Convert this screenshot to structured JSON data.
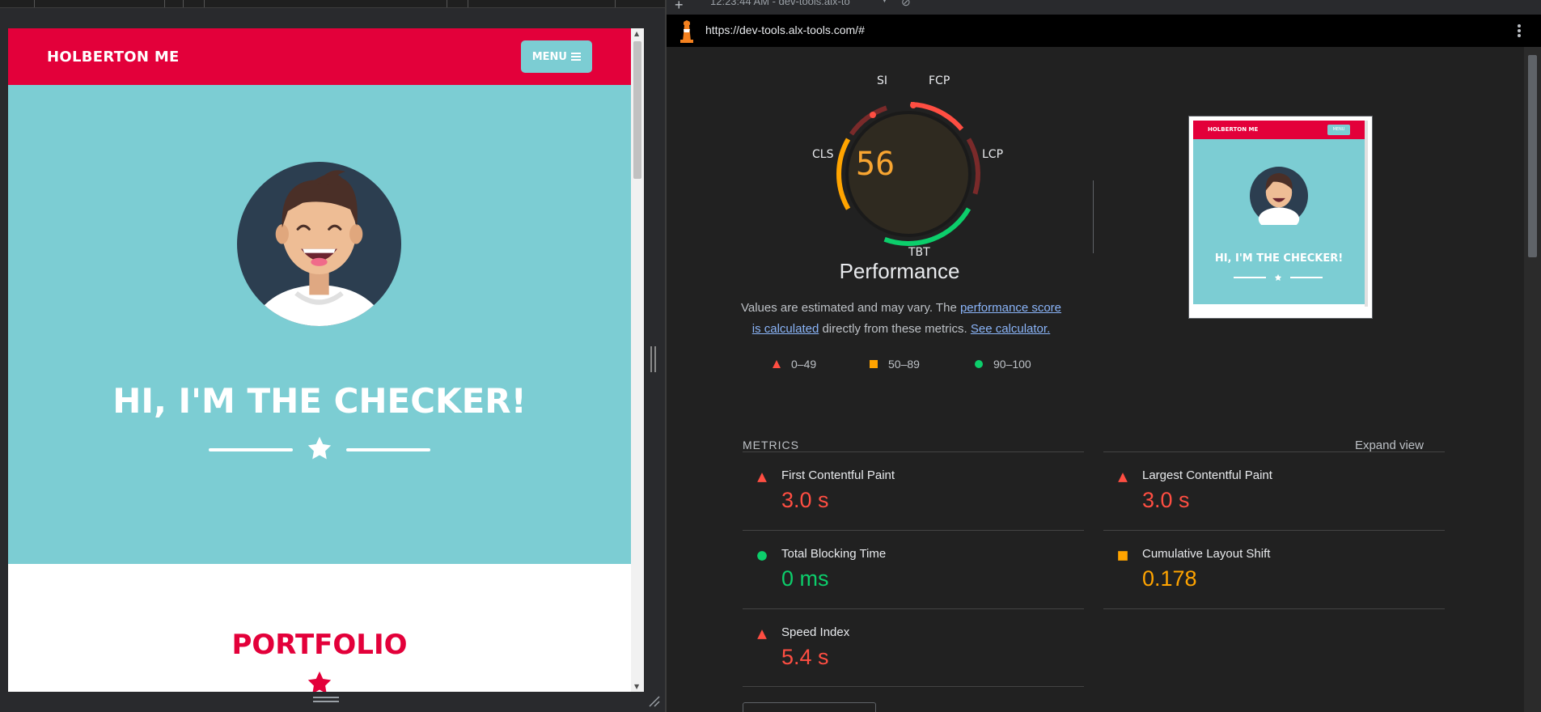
{
  "page": {
    "brand": "HOLBERTON ME",
    "menu_label": "MENU",
    "hero_title": "HI, I'M THE CHECKER!",
    "portfolio_title": "PORTFOLIO"
  },
  "devtools": {
    "timestamp": "12:23:44 AM - dev-tools.alx-to",
    "url": "https://dev-tools.alx-tools.com/#"
  },
  "report": {
    "score": "56",
    "score_color": "#f8a531",
    "category": "Performance",
    "gauge_labels": {
      "si": "SI",
      "fcp": "FCP",
      "lcp": "LCP",
      "tbt": "TBT",
      "cls": "CLS"
    },
    "desc_prefix": "Values are estimated and may vary. The ",
    "desc_link1": "performance score is calculated",
    "desc_middle": " directly from these metrics. ",
    "desc_link2": "See calculator.",
    "legend": [
      {
        "label": "0–49",
        "icon": "triangle",
        "color": "#ff4e42"
      },
      {
        "label": "50–89",
        "icon": "square",
        "color": "#ffa400"
      },
      {
        "label": "90–100",
        "icon": "circle",
        "color": "#0cce6b"
      }
    ],
    "metrics_title": "METRICS",
    "expand_label": "Expand view",
    "metrics": [
      {
        "name": "First Contentful Paint",
        "value": "3.0 s",
        "status": "fail",
        "icon": "triangle",
        "color": "#ff4e42"
      },
      {
        "name": "Largest Contentful Paint",
        "value": "3.0 s",
        "status": "fail",
        "icon": "triangle",
        "color": "#ff4e42"
      },
      {
        "name": "Total Blocking Time",
        "value": "0 ms",
        "status": "pass",
        "icon": "circle",
        "color": "#0cce6b"
      },
      {
        "name": "Cumulative Layout Shift",
        "value": "0.178",
        "status": "average",
        "icon": "square",
        "color": "#ffa400"
      },
      {
        "name": "Speed Index",
        "value": "5.4 s",
        "status": "fail",
        "icon": "triangle",
        "color": "#ff4e42"
      }
    ],
    "thumbnail": {
      "brand": "HOLBERTON ME",
      "menu": "MENU",
      "title": "HI, I'M THE CHECKER!"
    }
  }
}
